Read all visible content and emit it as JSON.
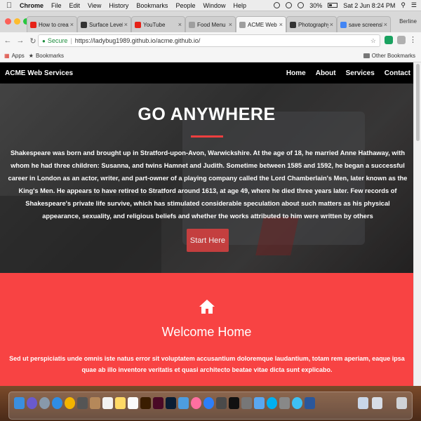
{
  "menubar": {
    "apple": "",
    "items": [
      "Chrome",
      "File",
      "Edit",
      "View",
      "History",
      "Bookmarks",
      "People",
      "Window",
      "Help"
    ],
    "battery": "30%",
    "datetime": "Sat 2 Jun  8:24 PM"
  },
  "browser": {
    "tabs": [
      {
        "label": "How to create a p",
        "favicon_color": "#e62117"
      },
      {
        "label": "Surface Level of F",
        "favicon_color": "#333333"
      },
      {
        "label": "YouTube",
        "favicon_color": "#e62117"
      },
      {
        "label": "Food Menu",
        "favicon_color": "#9e9e9e"
      },
      {
        "label": "ACME Web Servic",
        "favicon_color": "#9e9e9e"
      },
      {
        "label": "Photography",
        "favicon_color": "#333333"
      },
      {
        "label": "save screenshot o",
        "favicon_color": "#4285f4"
      }
    ],
    "profile": "Berline",
    "address": {
      "secure_label": "Secure",
      "url": "https://ladybug1989.github.io/acme.github.io/"
    },
    "bookmarks": {
      "apps": "Apps",
      "bookmarks": "Bookmarks",
      "other": "Other Bookmarks"
    }
  },
  "site": {
    "brand": "ACME Web Services",
    "nav": [
      "Home",
      "About",
      "Services",
      "Contact"
    ],
    "hero": {
      "title": "GO ANYWHERE",
      "text": "Shakespeare was born and brought up in Stratford-upon-Avon, Warwickshire. At the age of 18, he married Anne Hathaway, with whom he had three children: Susanna, and twins Hamnet and Judith. Sometime between 1585 and 1592, he began a successful career in London as an actor, writer, and part-owner of a playing company called the Lord Chamberlain's Men, later known as the King's Men. He appears to have retired to Stratford around 1613, at age 49, where he died three years later. Few records of Shakespeare's private life survive, which has stimulated considerable speculation about such matters as his physical appearance, sexuality, and religious beliefs and whether the works attributed to him were written by others",
      "button": "Start Here"
    },
    "welcome": {
      "title": "Welcome Home",
      "text": "Sed ut perspiciatis unde omnis iste natus error sit voluptatem accusantium doloremque laudantium, totam rem aperiam, eaque ipsa quae ab illo inventore veritatis et quasi architecto beatae vitae dicta sunt explicabo."
    },
    "colors": {
      "accent": "#f84343",
      "nav_bg": "#000000"
    }
  },
  "dock": {
    "icons": [
      "finder-icon",
      "siri-icon",
      "launchpad-icon",
      "safari-icon",
      "chrome-icon",
      "photo-icon",
      "contacts-icon",
      "calendar-icon",
      "notes-icon",
      "reminders-icon",
      "illustrator-icon",
      "indesign-icon",
      "photoshop-icon",
      "keynote-icon",
      "itunes-icon",
      "app-store-icon",
      "sublime-icon",
      "terminal-icon",
      "preferences-icon",
      "mail-icon",
      "skype-icon",
      "utility-icon",
      "messages-icon",
      "word-icon",
      "folder-icon",
      "folder-icon-2",
      "trash-icon"
    ]
  }
}
